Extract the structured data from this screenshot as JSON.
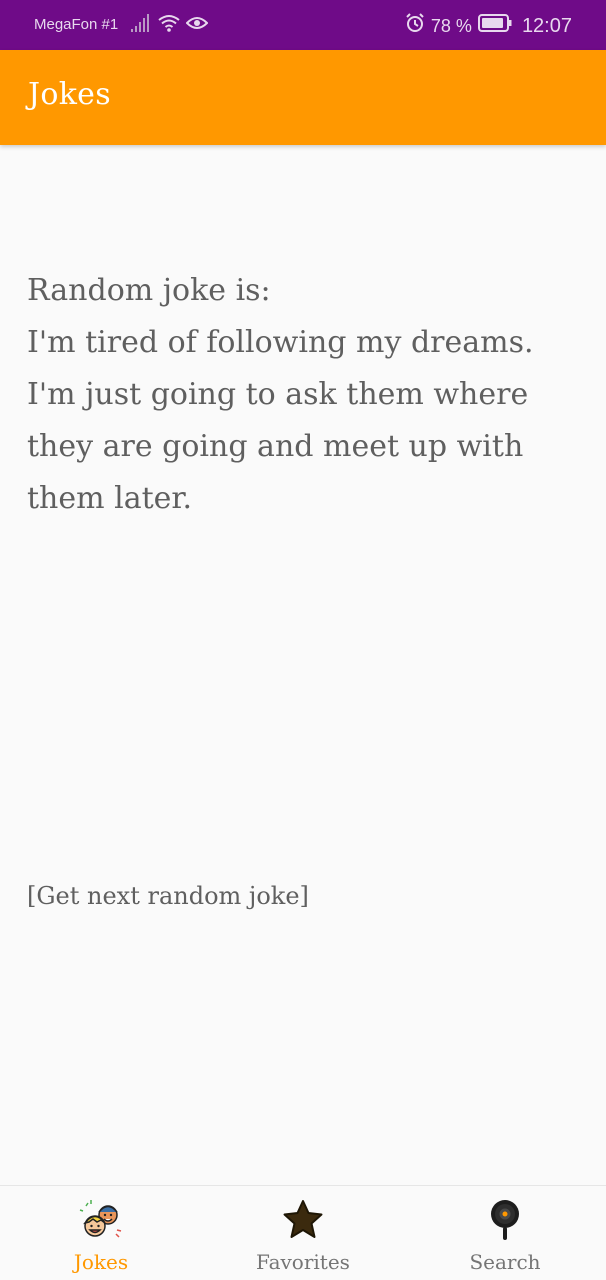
{
  "status_bar": {
    "carrier": "MegaFon #1",
    "battery_percent": "78 %",
    "time": "12:07",
    "icons": [
      "signal-icon",
      "wifi-icon",
      "eye-icon",
      "alarm-icon",
      "battery-icon"
    ]
  },
  "app_bar": {
    "title": "Jokes"
  },
  "content": {
    "heading": "Random joke is:",
    "joke": "I'm tired of following my dreams. I'm just going to ask them where they are going and meet up with them later.",
    "next_button": "[Get next random joke]"
  },
  "bottom_nav": {
    "items": [
      {
        "label": "Jokes",
        "icon": "jokes-faces-icon",
        "active": true
      },
      {
        "label": "Favorites",
        "icon": "star-icon",
        "active": false
      },
      {
        "label": "Search",
        "icon": "search-pan-icon",
        "active": false
      }
    ]
  },
  "colors": {
    "status_bar": "#6f0b88",
    "app_bar": "#ff9800",
    "active_nav": "#ff9800",
    "text": "#5f5f5f",
    "background": "#fafafa"
  }
}
